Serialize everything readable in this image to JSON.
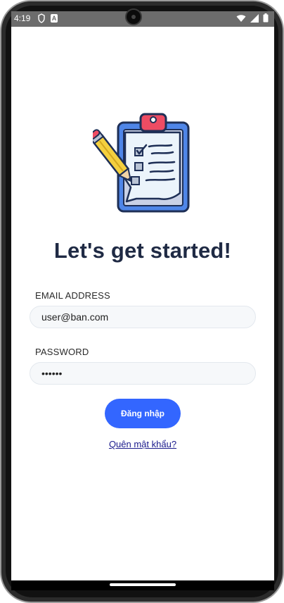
{
  "status_bar": {
    "time": "4:19",
    "icons": [
      "shield-icon",
      "a-notification-icon",
      "wifi-icon",
      "signal-icon",
      "battery-icon"
    ]
  },
  "colors": {
    "primary_button": "#3366ff",
    "title": "#1f2a44",
    "link": "#1a1a8c"
  },
  "main": {
    "title": "Let's get started!",
    "email_label": "EMAIL ADDRESS",
    "email_value": "user@ban.com",
    "password_label": "PASSWORD",
    "password_value": "••••••",
    "login_button": "Đăng nhập",
    "forgot_link": "Quên mật khẩu?"
  }
}
